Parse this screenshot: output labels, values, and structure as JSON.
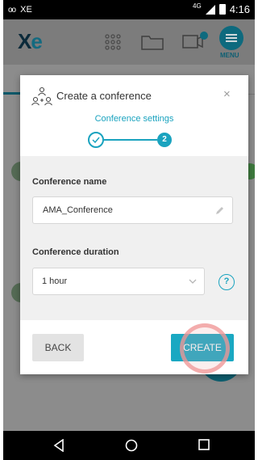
{
  "status_bar": {
    "left_glyph": "ᴏᴏ",
    "carrier": "XE",
    "network": "4G",
    "time": "4:16"
  },
  "app_header": {
    "logo_x": "X",
    "logo_e": "e",
    "menu_label": "MENU",
    "icons": [
      "grid-icon",
      "folder-icon",
      "video-call-icon",
      "menu-icon"
    ]
  },
  "dialog": {
    "title": "Create a conference",
    "step_label": "Conference settings",
    "step_current": "2",
    "fields": {
      "name_label": "Conference name",
      "name_value": "AMA_Conference",
      "duration_label": "Conference duration",
      "duration_value": "1 hour",
      "help": "?"
    },
    "buttons": {
      "back": "BACK",
      "create": "CREATE"
    },
    "close": "×"
  },
  "colors": {
    "accent": "#1aa3bf",
    "create_button": "#1aa8c2",
    "tap_indicator": "#f09696"
  }
}
